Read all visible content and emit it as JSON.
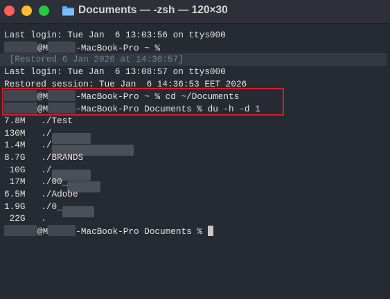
{
  "window": {
    "title": "Documents — -zsh — 120×30",
    "icons": [
      "close-icon",
      "minimize-icon",
      "maximize-icon",
      "folder-icon"
    ],
    "colors": {
      "background": "#262a33",
      "text": "#e4e4e4",
      "highlight_box": "#d41f27",
      "close": "#ff5f57",
      "minimize": "#febc2e",
      "maximize": "#28c840"
    }
  },
  "terminal": {
    "line1": "Last login: Tue Jan  6 13:03:56 on ttys000",
    "prompt1_at": "@M",
    "prompt1_host": "-MacBook-Pro ~ %",
    "restored_marker": " [Restored 6 Jan 2026 at 14:36:57]",
    "line4": "Last login: Tue Jan  6 13:08:57 on ttys000",
    "line5": "Restored session: Tue Jan  6 14:36:53 EET 2026",
    "cmd1_at": "@M",
    "cmd1_rest": "-MacBook-Pro ~ % cd ~/Documents",
    "cmd2_at": "@M",
    "cmd2_rest": "-MacBook-Pro Documents % du -h -d 1",
    "du_rows": [
      {
        "size": "7.8M",
        "path": "./Test"
      },
      {
        "size": "130M",
        "path": "./"
      },
      {
        "size": "1.4M",
        "path": "./"
      },
      {
        "size": "8.7G",
        "path": "./BRANDS"
      },
      {
        "size": " 10G",
        "path": "./"
      },
      {
        "size": " 17M",
        "path": "./00_"
      },
      {
        "size": "6.5M",
        "path": "./Adobe"
      },
      {
        "size": "1.9G",
        "path": "./0_"
      },
      {
        "size": " 22G",
        "path": "."
      }
    ],
    "final_at": "@M",
    "final_rest": "-MacBook-Pro Documents % "
  }
}
